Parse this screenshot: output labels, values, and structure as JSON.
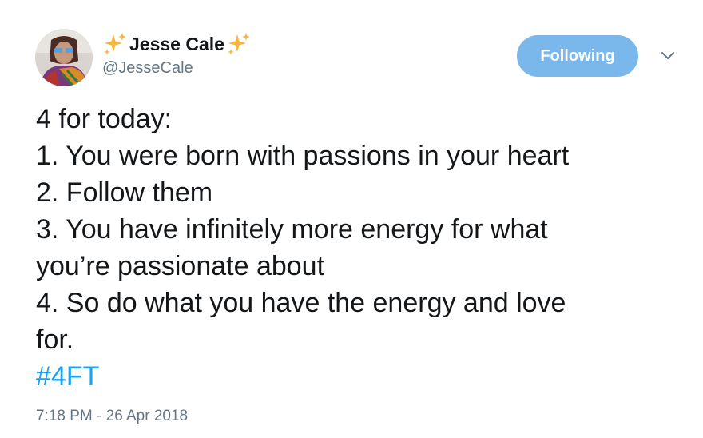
{
  "tweet": {
    "author": {
      "display_name": "Jesse Cale",
      "handle": "@JesseCale",
      "name_decoration_icon": "sparkles-icon"
    },
    "follow_button_label": "Following",
    "menu_icon": "chevron-down-icon",
    "body_lines": [
      "4 for today:",
      "1. You were born with passions in your heart",
      "2. Follow them",
      "3. You have infinitely more energy for what",
      "you’re passionate about",
      "4. So do what you have the energy and love",
      "for."
    ],
    "hashtag": "#4FT",
    "timestamp": "7:18 PM - 26 Apr 2018"
  },
  "colors": {
    "text_primary": "#14171a",
    "text_secondary": "#657786",
    "accent": "#1da1f2",
    "follow_button_bg": "#7ab8ec",
    "sparkle": "#f5b53f"
  }
}
